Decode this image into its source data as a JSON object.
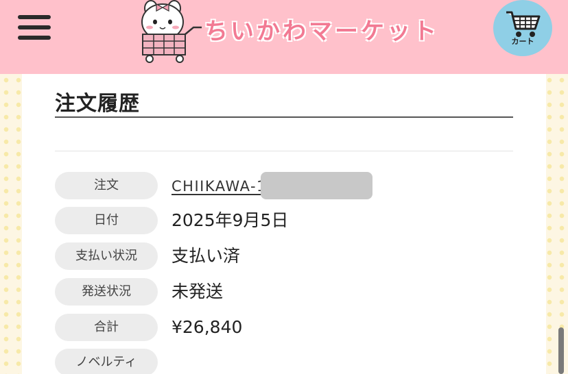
{
  "header": {
    "logo_text": "ちいかわマーケット",
    "cart_label": "カート"
  },
  "page": {
    "title": "注文履歴"
  },
  "order": {
    "fields": [
      {
        "label": "注文",
        "value": "CHIIKAWA-1"
      },
      {
        "label": "日付",
        "value": "2025年9月5日"
      },
      {
        "label": "支払い状況",
        "value": "支払い済"
      },
      {
        "label": "発送状況",
        "value": "未発送"
      },
      {
        "label": "合計",
        "value": "¥26,840"
      },
      {
        "label": "ノベルティ",
        "value": ""
      }
    ]
  },
  "colors": {
    "header_bg": "#ffc1cb",
    "logo_pink": "#f27a93",
    "cart_blue": "#8fcfe6",
    "pill_bg": "#ececec"
  },
  "icons": {
    "menu": "hamburger-menu-icon",
    "cart": "shopping-cart-icon",
    "mascot": "chiikawa-mascot-in-cart"
  }
}
